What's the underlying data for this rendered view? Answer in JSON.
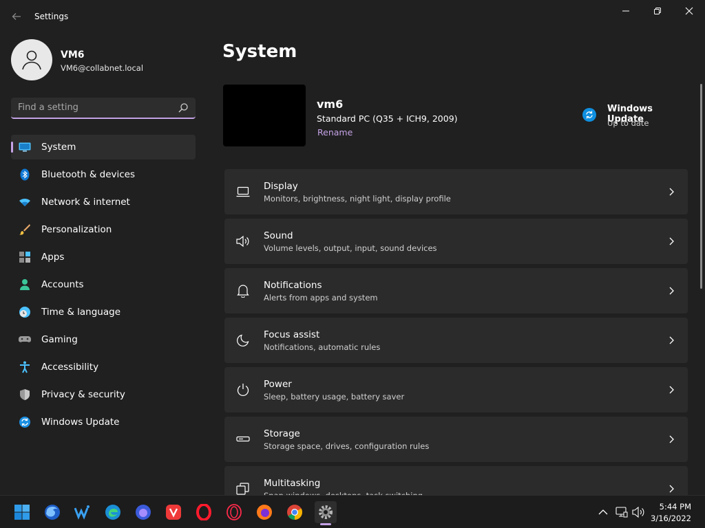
{
  "window": {
    "title": "Settings"
  },
  "profile": {
    "name": "VM6",
    "email": "VM6@collabnet.local"
  },
  "search": {
    "placeholder": "Find a setting"
  },
  "sidebar": {
    "items": [
      {
        "label": "System",
        "icon": "system-icon",
        "active": true
      },
      {
        "label": "Bluetooth & devices",
        "icon": "bluetooth-icon"
      },
      {
        "label": "Network & internet",
        "icon": "wifi-icon"
      },
      {
        "label": "Personalization",
        "icon": "brush-icon"
      },
      {
        "label": "Apps",
        "icon": "apps-icon"
      },
      {
        "label": "Accounts",
        "icon": "account-icon"
      },
      {
        "label": "Time & language",
        "icon": "clock-globe-icon"
      },
      {
        "label": "Gaming",
        "icon": "gamepad-icon"
      },
      {
        "label": "Accessibility",
        "icon": "accessibility-icon"
      },
      {
        "label": "Privacy & security",
        "icon": "shield-icon"
      },
      {
        "label": "Windows Update",
        "icon": "update-icon"
      }
    ]
  },
  "main": {
    "title": "System",
    "device": {
      "name": "vm6",
      "model": "Standard PC (Q35 + ICH9, 2009)",
      "rename_label": "Rename"
    },
    "windows_update": {
      "title": "Windows Update",
      "status": "Up to date"
    },
    "cards": [
      {
        "title": "Display",
        "subtitle": "Monitors, brightness, night light, display profile",
        "icon": "monitor-icon"
      },
      {
        "title": "Sound",
        "subtitle": "Volume levels, output, input, sound devices",
        "icon": "speaker-icon"
      },
      {
        "title": "Notifications",
        "subtitle": "Alerts from apps and system",
        "icon": "bell-icon"
      },
      {
        "title": "Focus assist",
        "subtitle": "Notifications, automatic rules",
        "icon": "moon-icon"
      },
      {
        "title": "Power",
        "subtitle": "Sleep, battery usage, battery saver",
        "icon": "power-icon"
      },
      {
        "title": "Storage",
        "subtitle": "Storage space, drives, configuration rules",
        "icon": "storage-icon"
      },
      {
        "title": "Multitasking",
        "subtitle": "Snap windows, desktops, task switching",
        "icon": "multitasking-icon"
      }
    ]
  },
  "taskbar": {
    "apps": [
      "start-icon",
      "firefox-nightly-icon",
      "waterfox-icon",
      "edge-icon",
      "firefox-dev-icon",
      "vivaldi-icon",
      "opera-icon",
      "opera-gx-icon",
      "firefox-icon",
      "chrome-icon",
      "settings-gear-icon"
    ],
    "tray": [
      "chevron-up-icon",
      "network-icon",
      "volume-icon"
    ],
    "time": "5:44 PM",
    "date": "3/16/2022"
  },
  "colors": {
    "background": "#202020",
    "card": "#2b2b2b",
    "accent": "#c5a3e6",
    "update_blue": "#0f8fe0"
  }
}
